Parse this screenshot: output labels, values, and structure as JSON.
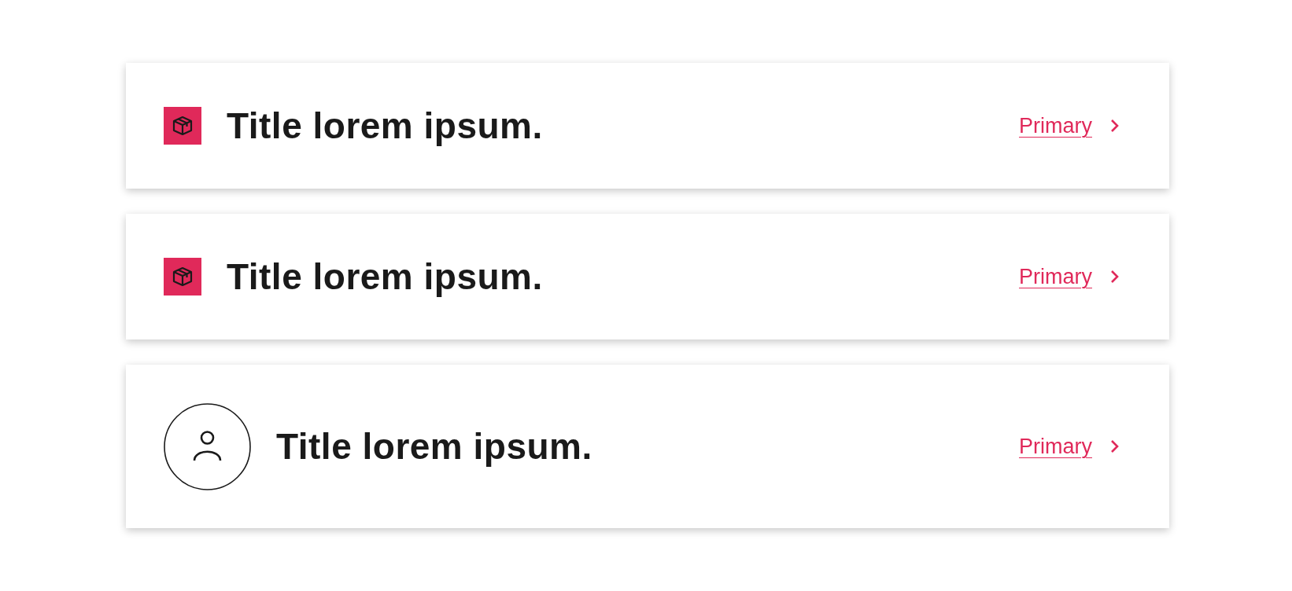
{
  "cards": [
    {
      "kind": "box",
      "title": "Title lorem ipsum.",
      "link": "Primary"
    },
    {
      "kind": "box",
      "title": "Title lorem ipsum.",
      "link": "Primary"
    },
    {
      "kind": "avatar",
      "title": "Title lorem ipsum.",
      "link": "Primary"
    }
  ]
}
